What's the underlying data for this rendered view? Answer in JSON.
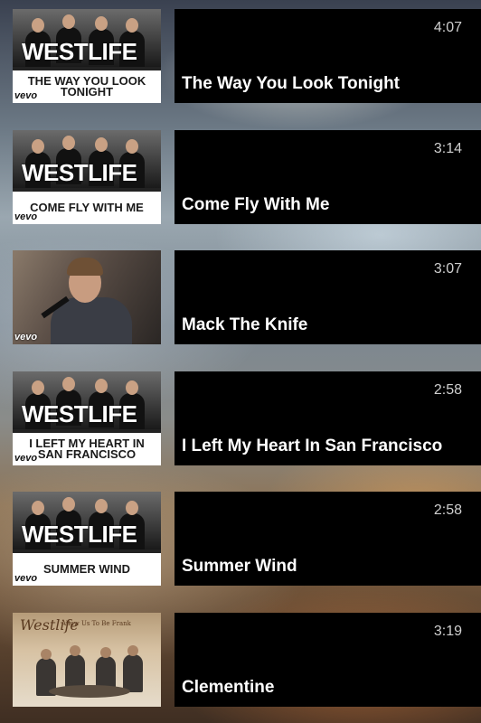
{
  "videos": [
    {
      "title": "The Way You Look Tonight",
      "duration": "4:07",
      "thumbnail": {
        "style": "westlife",
        "logo": "WESTLIFE",
        "caption": "THE WAY YOU LOOK TONIGHT",
        "vevo": "vevo"
      }
    },
    {
      "title": "Come Fly With Me",
      "duration": "3:14",
      "thumbnail": {
        "style": "westlife",
        "logo": "WESTLIFE",
        "caption": "COME FLY WITH ME",
        "vevo": "vevo"
      }
    },
    {
      "title": "Mack The Knife",
      "duration": "3:07",
      "thumbnail": {
        "style": "performer",
        "vevo": "vevo"
      }
    },
    {
      "title": "I Left My Heart In San Francisco",
      "duration": "2:58",
      "thumbnail": {
        "style": "westlife",
        "logo": "WESTLIFE",
        "caption": "I LEFT MY HEART IN SAN FRANCISCO",
        "vevo": "vevo"
      }
    },
    {
      "title": "Summer Wind",
      "duration": "2:58",
      "thumbnail": {
        "style": "westlife",
        "logo": "WESTLIFE",
        "caption": "SUMMER WIND",
        "vevo": "vevo"
      }
    },
    {
      "title": "Clementine",
      "duration": "3:19",
      "thumbnail": {
        "style": "album",
        "logo": "Westlife",
        "album_text": "Allow Us To Be Frank"
      }
    }
  ]
}
